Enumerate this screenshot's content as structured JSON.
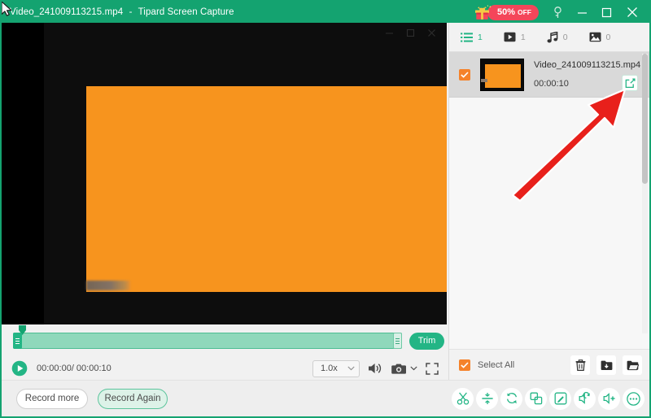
{
  "window": {
    "file_title": "Video_241009113215.mp4",
    "separator": "-",
    "app_title": "Tipard Screen Capture",
    "titlebar_color": "#14a370",
    "controls": {
      "help_icon": "key-icon",
      "minimize_icon": "minimize-icon",
      "maximize_icon": "maximize-icon",
      "close_icon": "close-icon"
    }
  },
  "promo": {
    "icon": "gift-icon",
    "percent": "50%",
    "off_label": "OFF",
    "badge_color": "#f4465a"
  },
  "preview": {
    "inner_window_controls": {
      "minimize_icon": "minimize-icon",
      "maximize_icon": "maximize-icon",
      "close_icon": "close-icon"
    },
    "content_color": "#f7941e",
    "background_color": "#000000"
  },
  "timeline": {
    "trim_label": "Trim",
    "playhead_icon": "playhead-marker-icon",
    "left_handle_icon": "trim-handle-left-icon",
    "right_handle_icon": "trim-handle-right-icon",
    "track_color": "#8fd8bb",
    "accent_color": "#23b585"
  },
  "playback": {
    "play_icon": "play-icon",
    "current_time": "00:00:00",
    "time_separator": "/",
    "total_time": "00:00:10",
    "time_display": "00:00:00/ 00:00:10",
    "speed_value": "1.0x",
    "speed_caret_icon": "chevron-down-icon",
    "volume_icon": "volume-icon",
    "snapshot_icon": "camera-icon",
    "snapshot_caret_icon": "chevron-down-icon",
    "fullscreen_icon": "fullscreen-icon"
  },
  "record": {
    "record_more_label": "Record more",
    "record_again_label": "Record Again"
  },
  "right_panel": {
    "tabs": [
      {
        "icon": "list-icon",
        "count": "1",
        "active": true
      },
      {
        "icon": "video-icon",
        "count": "1",
        "active": false
      },
      {
        "icon": "music-note-icon",
        "count": "0",
        "active": false
      },
      {
        "icon": "image-icon",
        "count": "0",
        "active": false
      }
    ],
    "files": [
      {
        "checked": true,
        "check_icon": "checkmark-icon",
        "thumbnail": "video-thumbnail",
        "name": "Video_241009113215.mp4",
        "duration": "00:00:10",
        "share_icon": "share-export-icon"
      }
    ],
    "select_all": {
      "label": "Select All",
      "checked": true,
      "check_icon": "checkmark-icon",
      "checkbox_color": "#f5822a"
    },
    "actions": [
      {
        "icon": "trash-icon"
      },
      {
        "icon": "save-to-folder-icon"
      },
      {
        "icon": "open-folder-icon"
      }
    ]
  },
  "bottom_toolbar": {
    "tools": [
      {
        "icon": "scissors-cut-icon"
      },
      {
        "icon": "split-compress-icon"
      },
      {
        "icon": "convert-rotate-icon"
      },
      {
        "icon": "merge-icon"
      },
      {
        "icon": "edit-pencil-icon"
      },
      {
        "icon": "audio-extract-icon"
      },
      {
        "icon": "volume-boost-icon"
      },
      {
        "icon": "more-options-icon"
      }
    ],
    "accent_color": "#23b585"
  },
  "annotation": {
    "arrow_icon": "red-arrow-icon",
    "arrow_color": "#e8201b",
    "cursor_icon": "mouse-pointer-icon"
  }
}
